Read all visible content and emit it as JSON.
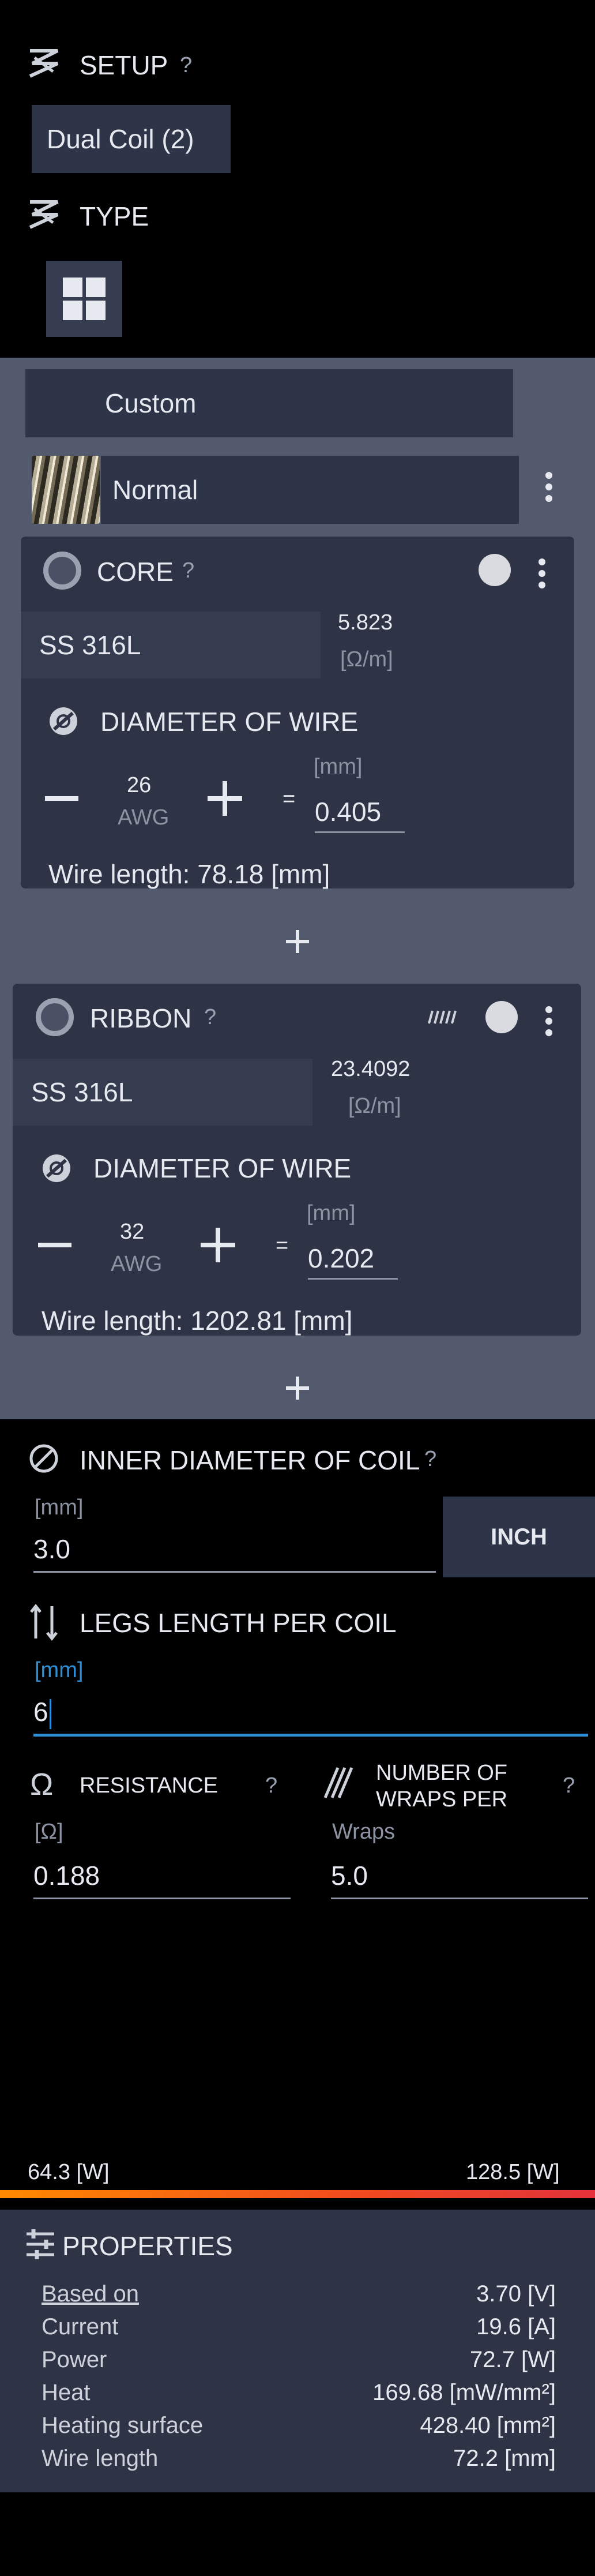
{
  "setup": {
    "label": "SETUP",
    "help": "?",
    "value": "Dual Coil (2)"
  },
  "type": {
    "label": "TYPE"
  },
  "coil_type": {
    "custom_label": "Custom",
    "normal_label": "Normal"
  },
  "core": {
    "title": "CORE",
    "help": "?",
    "material": "SS 316L",
    "resistance_value": "5.823",
    "resistance_unit": "[Ω/m]",
    "diameter_label": "DIAMETER OF WIRE",
    "gauge": "26",
    "gauge_unit": "AWG",
    "equals": "=",
    "mm_unit": "[mm]",
    "mm_value": "0.405",
    "wire_length": "Wire length: 78.18 [mm]"
  },
  "ribbon": {
    "title": "RIBBON",
    "help": "?",
    "material": "SS 316L",
    "resistance_value": "23.4092",
    "resistance_unit": "[Ω/m]",
    "diameter_label": "DIAMETER OF WIRE",
    "gauge": "32",
    "gauge_unit": "AWG",
    "equals": "=",
    "mm_unit": "[mm]",
    "mm_value": "0.202",
    "wire_length": "Wire length: 1202.81 [mm]"
  },
  "inner_diameter": {
    "label": "INNER DIAMETER OF COIL",
    "help": "?",
    "unit": "[mm]",
    "value": "3.0",
    "inch_button": "INCH"
  },
  "legs": {
    "label": "LEGS LENGTH PER COIL",
    "unit": "[mm]",
    "value": "6"
  },
  "resistance": {
    "label": "RESISTANCE",
    "help": "?",
    "unit": "[Ω]",
    "value": "0.188",
    "symbol": "Ω"
  },
  "wraps": {
    "label": "NUMBER OF WRAPS PER",
    "help": "?",
    "unit": "Wraps",
    "value": "5.0"
  },
  "power_range": {
    "min": "64.3 [W]",
    "max": "128.5 [W]"
  },
  "properties": {
    "title": "PROPERTIES",
    "rows": [
      {
        "label": "Based on",
        "value": "3.70 [V]"
      },
      {
        "label": "Current",
        "value": "19.6 [A]"
      },
      {
        "label": "Power",
        "value": "72.7 [W]"
      },
      {
        "label": "Heat",
        "value": "169.68 [mW/mm²]"
      },
      {
        "label": "Heating surface",
        "value": "428.40 [mm²]"
      },
      {
        "label": "Wire length",
        "value": "72.2 [mm]"
      }
    ]
  },
  "colors": {
    "background": "#000000",
    "panel": "#2e3446",
    "field": "#353c50",
    "accent": "#2f8fd6",
    "gradient_start": "#ff8a00",
    "gradient_end": "#e3323a"
  }
}
